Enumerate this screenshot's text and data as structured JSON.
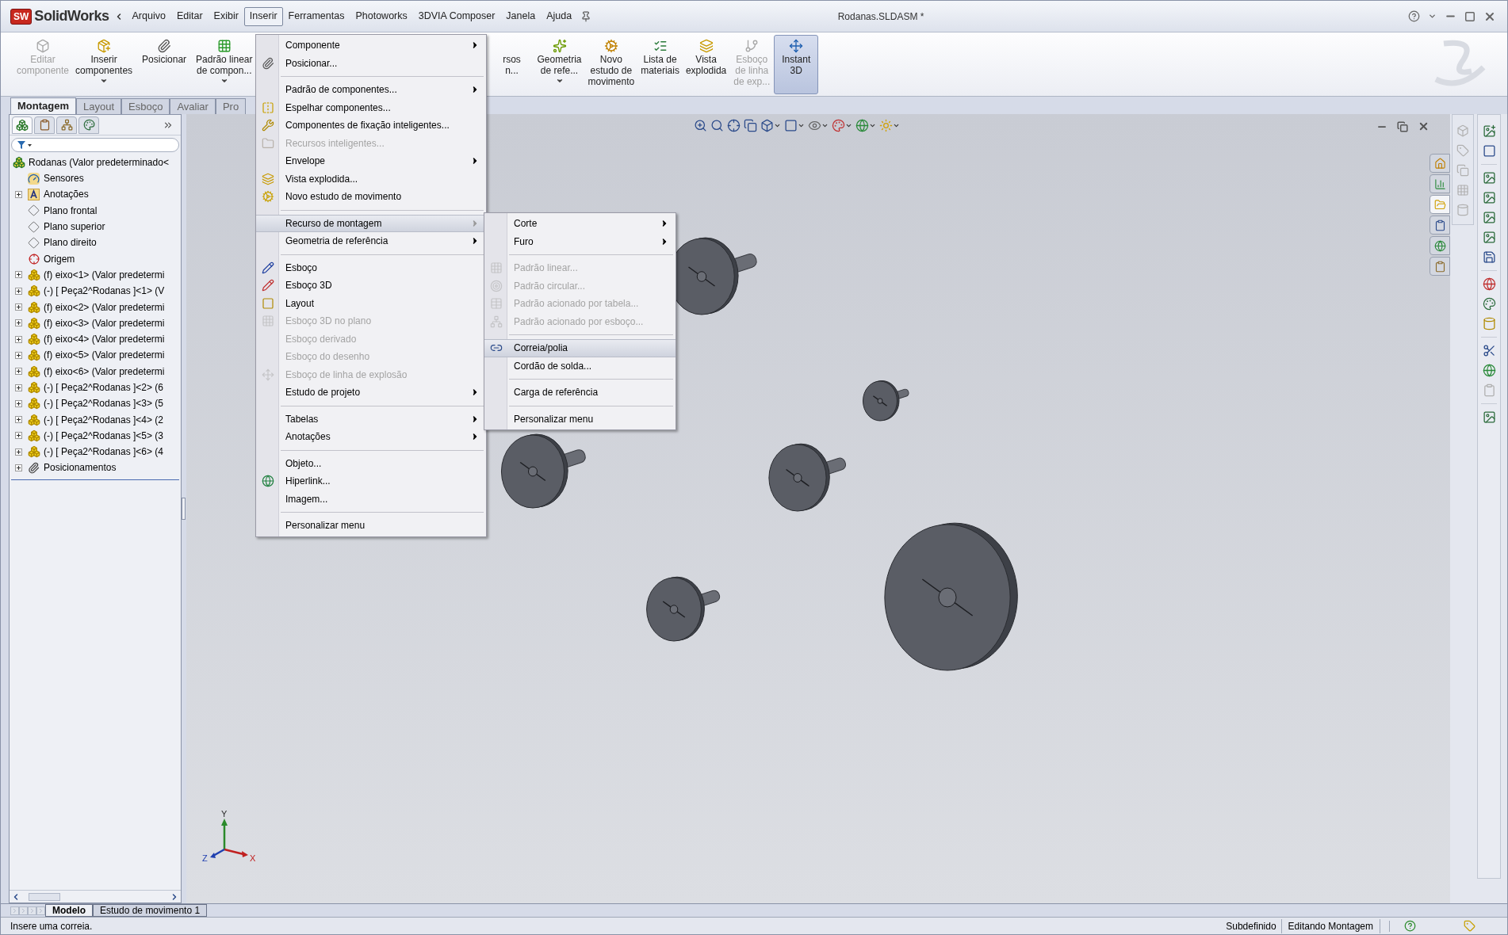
{
  "app": {
    "logo_badge": "SW",
    "logo_name": "SolidWorks"
  },
  "menu_bar": [
    {
      "label": "Arquivo",
      "selected": false
    },
    {
      "label": "Editar",
      "selected": false
    },
    {
      "label": "Exibir",
      "selected": false
    },
    {
      "label": "Inserir",
      "selected": true
    },
    {
      "label": "Ferramentas",
      "selected": false
    },
    {
      "label": "Photoworks",
      "selected": false
    },
    {
      "label": "3DVIA Composer",
      "selected": false
    },
    {
      "label": "Janela",
      "selected": false
    },
    {
      "label": "Ajuda",
      "selected": false
    }
  ],
  "window": {
    "title": "Rodanas.SLDASM *"
  },
  "toolbar": [
    {
      "lines": [
        "Editar",
        "componente"
      ],
      "disabled": true,
      "selected": false,
      "dropdown": false
    },
    {
      "lines": [
        "Inserir",
        "componentes"
      ],
      "disabled": false,
      "selected": false,
      "dropdown": true
    },
    {
      "lines": [
        "Posicionar"
      ],
      "disabled": false,
      "selected": false,
      "dropdown": false
    },
    {
      "lines": [
        "Padrão linear",
        "de compon..."
      ],
      "disabled": false,
      "selected": false,
      "dropdown": true
    },
    {
      "lines": [
        "rsos",
        "n..."
      ],
      "disabled": false,
      "selected": false,
      "dropdown": false
    },
    {
      "lines": [
        "Geometria",
        "de refe..."
      ],
      "disabled": false,
      "selected": false,
      "dropdown": true
    },
    {
      "lines": [
        "Novo",
        "estudo de",
        "movimento"
      ],
      "disabled": false,
      "selected": false,
      "dropdown": false
    },
    {
      "lines": [
        "Lista de",
        "materiais"
      ],
      "disabled": false,
      "selected": false,
      "dropdown": false
    },
    {
      "lines": [
        "Vista",
        "explodida"
      ],
      "disabled": false,
      "selected": false,
      "dropdown": false
    },
    {
      "lines": [
        "Esboço",
        "de linha",
        "de exp..."
      ],
      "disabled": true,
      "selected": false,
      "dropdown": false
    },
    {
      "lines": [
        "Instant",
        "3D"
      ],
      "disabled": false,
      "selected": true,
      "dropdown": false
    }
  ],
  "command_tabs": [
    {
      "label": "Montagem",
      "selected": true
    },
    {
      "label": "Layout",
      "selected": false
    },
    {
      "label": "Esboço",
      "selected": false
    },
    {
      "label": "Avaliar",
      "selected": false
    },
    {
      "label": "Pro",
      "selected": false
    }
  ],
  "feature_tree": {
    "root": "Rodanas  (Valor predeterminado<",
    "items": [
      {
        "label": "Sensores",
        "kind": "sensors",
        "expandable": false
      },
      {
        "label": "Anotações",
        "kind": "annotations",
        "expandable": true
      },
      {
        "label": "Plano frontal",
        "kind": "plane",
        "expandable": false
      },
      {
        "label": "Plano superior",
        "kind": "plane",
        "expandable": false
      },
      {
        "label": "Plano direito",
        "kind": "plane",
        "expandable": false
      },
      {
        "label": "Origem",
        "kind": "origin",
        "expandable": false
      },
      {
        "label": "(f) eixo<1> (Valor predetermi",
        "kind": "part",
        "expandable": true
      },
      {
        "label": "(-) [ Peça2^Rodanas ]<1> (V",
        "kind": "part",
        "expandable": true
      },
      {
        "label": "(f) eixo<2> (Valor predetermi",
        "kind": "part",
        "expandable": true
      },
      {
        "label": "(f) eixo<3> (Valor predetermi",
        "kind": "part",
        "expandable": true
      },
      {
        "label": "(f) eixo<4> (Valor predetermi",
        "kind": "part",
        "expandable": true
      },
      {
        "label": "(f) eixo<5> (Valor predetermi",
        "kind": "part",
        "expandable": true
      },
      {
        "label": "(f) eixo<6> (Valor predetermi",
        "kind": "part",
        "expandable": true
      },
      {
        "label": "(-) [ Peça2^Rodanas ]<2> (6",
        "kind": "part",
        "expandable": true
      },
      {
        "label": "(-) [ Peça2^Rodanas ]<3> (5",
        "kind": "part",
        "expandable": true
      },
      {
        "label": "(-) [ Peça2^Rodanas ]<4> (2",
        "kind": "part",
        "expandable": true
      },
      {
        "label": "(-) [ Peça2^Rodanas ]<5> (3",
        "kind": "part",
        "expandable": true
      },
      {
        "label": "(-) [ Peça2^Rodanas ]<6> (4",
        "kind": "part",
        "expandable": true
      },
      {
        "label": "Posicionamentos",
        "kind": "mates",
        "expandable": true
      }
    ]
  },
  "insert_menu": {
    "groups": [
      [
        {
          "label": "Componente",
          "submenu": true,
          "disabled": false,
          "selected": false
        },
        {
          "label": "Posicionar...",
          "submenu": false,
          "disabled": false,
          "selected": false
        }
      ],
      [
        {
          "label": "Padrão de componentes...",
          "submenu": true,
          "disabled": false,
          "selected": false
        },
        {
          "label": "Espelhar componentes...",
          "submenu": false,
          "disabled": false,
          "selected": false
        },
        {
          "label": "Componentes de fixação inteligentes...",
          "submenu": false,
          "disabled": false,
          "selected": false
        },
        {
          "label": "Recursos inteligentes...",
          "submenu": false,
          "disabled": true,
          "selected": false
        },
        {
          "label": "Envelope",
          "submenu": true,
          "disabled": false,
          "selected": false
        },
        {
          "label": "Vista explodida...",
          "submenu": false,
          "disabled": false,
          "selected": false
        },
        {
          "label": "Novo estudo de movimento",
          "submenu": false,
          "disabled": false,
          "selected": false
        }
      ],
      [
        {
          "label": "Recurso de montagem",
          "submenu": true,
          "disabled": false,
          "selected": true
        },
        {
          "label": "Geometria de referência",
          "submenu": true,
          "disabled": false,
          "selected": false
        }
      ],
      [
        {
          "label": "Esboço",
          "submenu": false,
          "disabled": false,
          "selected": false
        },
        {
          "label": "Esboço 3D",
          "submenu": false,
          "disabled": false,
          "selected": false
        },
        {
          "label": "Layout",
          "submenu": false,
          "disabled": false,
          "selected": false
        },
        {
          "label": "Esboço 3D no plano",
          "submenu": false,
          "disabled": true,
          "selected": false
        },
        {
          "label": "Esboço derivado",
          "submenu": false,
          "disabled": true,
          "selected": false
        },
        {
          "label": "Esboço do desenho",
          "submenu": false,
          "disabled": true,
          "selected": false
        },
        {
          "label": "Esboço de linha de explosão",
          "submenu": false,
          "disabled": true,
          "selected": false
        },
        {
          "label": "Estudo de projeto",
          "submenu": true,
          "disabled": false,
          "selected": false
        }
      ],
      [
        {
          "label": "Tabelas",
          "submenu": true,
          "disabled": false,
          "selected": false
        },
        {
          "label": "Anotações",
          "submenu": true,
          "disabled": false,
          "selected": false
        }
      ],
      [
        {
          "label": "Objeto...",
          "submenu": false,
          "disabled": false,
          "selected": false
        },
        {
          "label": "Hiperlink...",
          "submenu": false,
          "disabled": false,
          "selected": false
        },
        {
          "label": "Imagem...",
          "submenu": false,
          "disabled": false,
          "selected": false
        }
      ],
      [
        {
          "label": "Personalizar menu",
          "submenu": false,
          "disabled": false,
          "selected": false
        }
      ]
    ]
  },
  "assembly_feature_submenu": {
    "groups": [
      [
        {
          "label": "Corte",
          "submenu": true,
          "disabled": false,
          "selected": false
        },
        {
          "label": "Furo",
          "submenu": true,
          "disabled": false,
          "selected": false
        }
      ],
      [
        {
          "label": "Padrão linear...",
          "submenu": false,
          "disabled": true,
          "selected": false
        },
        {
          "label": "Padrão circular...",
          "submenu": false,
          "disabled": true,
          "selected": false
        },
        {
          "label": "Padrão acionado por tabela...",
          "submenu": false,
          "disabled": true,
          "selected": false
        },
        {
          "label": "Padrão acionado por esboço...",
          "submenu": false,
          "disabled": true,
          "selected": false
        }
      ],
      [
        {
          "label": "Correia/polia",
          "submenu": false,
          "disabled": false,
          "selected": true
        },
        {
          "label": "Cordão de solda...",
          "submenu": false,
          "disabled": false,
          "selected": false
        }
      ],
      [
        {
          "label": "Carga de referência",
          "submenu": false,
          "disabled": false,
          "selected": false
        }
      ],
      [
        {
          "label": "Personalizar menu",
          "submenu": false,
          "disabled": false,
          "selected": false
        }
      ]
    ]
  },
  "viewport": {
    "triad": {
      "x": "X",
      "y": "Y",
      "z": "Z"
    }
  },
  "task_pane_tabs": [
    {
      "selected": false
    },
    {
      "selected": false
    },
    {
      "selected": true
    },
    {
      "selected": false
    },
    {
      "selected": false
    },
    {
      "selected": false
    }
  ],
  "bottom_tabs": [
    {
      "label": "Modelo",
      "selected": true
    },
    {
      "label": "Estudo de movimento 1",
      "selected": false
    }
  ],
  "status_bar": {
    "message": "Insere uma correia.",
    "state": "Subdefinido",
    "mode": "Editando Montagem"
  }
}
